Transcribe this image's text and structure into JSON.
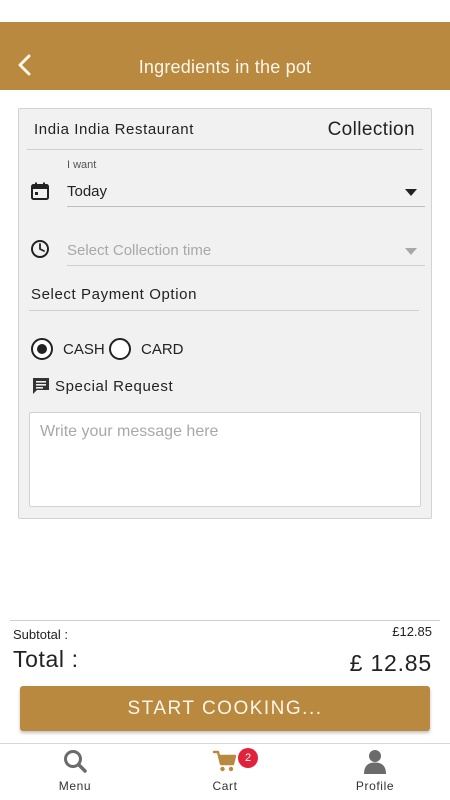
{
  "header": {
    "title": "Ingredients in the pot",
    "color": "#b8893e"
  },
  "order": {
    "restaurant_name": "India India Restaurant",
    "order_type": "Collection",
    "want_label": "I want",
    "date_value": "Today",
    "time_placeholder": "Select Collection time",
    "payment_label": "Select Payment Option",
    "payment_options": [
      {
        "label": "CASH",
        "selected": true
      },
      {
        "label": "CARD",
        "selected": false
      }
    ],
    "special_request_label": "Special Request",
    "message_placeholder": "Write your message here"
  },
  "summary": {
    "subtotal_label": "Subtotal :",
    "subtotal_value": "£12.85",
    "total_label": "Total :",
    "total_value": "£ 12.85"
  },
  "cta": {
    "label": "START COOKING..."
  },
  "nav": {
    "items": [
      {
        "label": "Menu",
        "icon": "search-icon"
      },
      {
        "label": "Cart",
        "icon": "cart-icon",
        "badge": "2"
      },
      {
        "label": "Profile",
        "icon": "person-icon"
      }
    ],
    "active_color": "#b8893e",
    "badge_color": "#e0223a"
  },
  "icons": {
    "back": "chevron-left-icon",
    "date": "calendar-icon",
    "time": "clock-icon",
    "dropdown": "caret-down-icon",
    "special": "chat-bubble-icon"
  }
}
